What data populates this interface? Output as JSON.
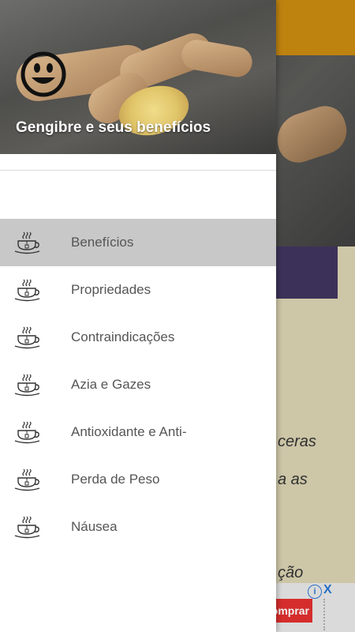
{
  "drawer": {
    "header_title": "Gengibre e seus benefícios",
    "items": [
      {
        "label": "Benefícios",
        "icon": "tea-cup-icon",
        "active": true
      },
      {
        "label": "Propriedades",
        "icon": "tea-cup-icon",
        "active": false
      },
      {
        "label": "Contraindicações",
        "icon": "tea-cup-icon",
        "active": false
      },
      {
        "label": "Azia e Gazes",
        "icon": "tea-cup-icon",
        "active": false
      },
      {
        "label": "Antioxidante e Anti-",
        "icon": "tea-cup-icon",
        "active": false
      },
      {
        "label": "Perda de Peso",
        "icon": "tea-cup-icon",
        "active": false
      },
      {
        "label": "Náusea",
        "icon": "tea-cup-icon",
        "active": false
      }
    ]
  },
  "background": {
    "text_lines": [
      "ceras",
      "a as",
      "ção"
    ],
    "ad": {
      "button_label": "omprar",
      "info_icon": "i",
      "close_icon": "X"
    }
  },
  "colors": {
    "toolbar": "#c98a10",
    "active_item_bg": "#c8c8c8",
    "banner": "#40355e",
    "content_bg": "#d8d1b0",
    "ad_button": "#e0302f"
  }
}
